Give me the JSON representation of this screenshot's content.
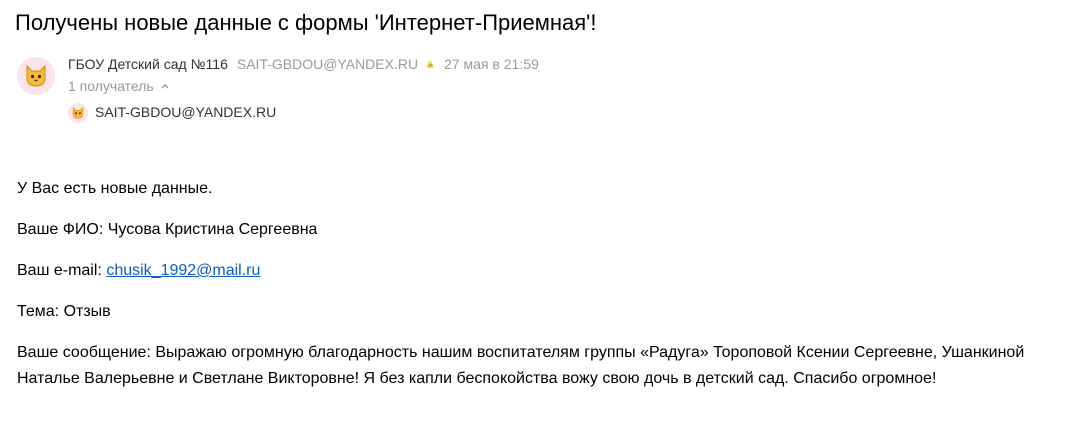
{
  "email": {
    "subject": "Получены новые данные с формы 'Интернет-Приемная'!",
    "sender": {
      "name": "ГБОУ Детский сад №116",
      "email": "SAIT-GBDOU@YANDEX.RU",
      "date": "27 мая в 21:59",
      "avatar_icon": "cat-face-icon",
      "verified_icon": "verified-sender-icon"
    },
    "recipients_toggle": "1 получатель",
    "recipients": [
      {
        "email": "SAIT-GBDOU@YANDEX.RU"
      }
    ],
    "body": {
      "intro": "У Вас есть новые данные.",
      "fio_label": "Ваше ФИО: ",
      "fio_value": "Чусова Кристина Сергеевна",
      "email_label": "Ваш e-mail: ",
      "email_value": "chusik_1992@mail.ru",
      "topic_label": "Тема: ",
      "topic_value": "Отзыв",
      "message_label": "Ваше сообщение: ",
      "message_value": "Выражаю огромную благодарность нашим воспитателям группы «Радуга» Тороповой Ксении Сергеевне, Ушанкиной Наталье Валерьевне и Светлане Викторовне! Я без капли беспокойства вожу свою дочь в детский сад. Спасибо огромное!"
    }
  },
  "colors": {
    "link": "#0a5dc2",
    "muted": "#999999",
    "avatar_bg": "#fbe3ea"
  }
}
